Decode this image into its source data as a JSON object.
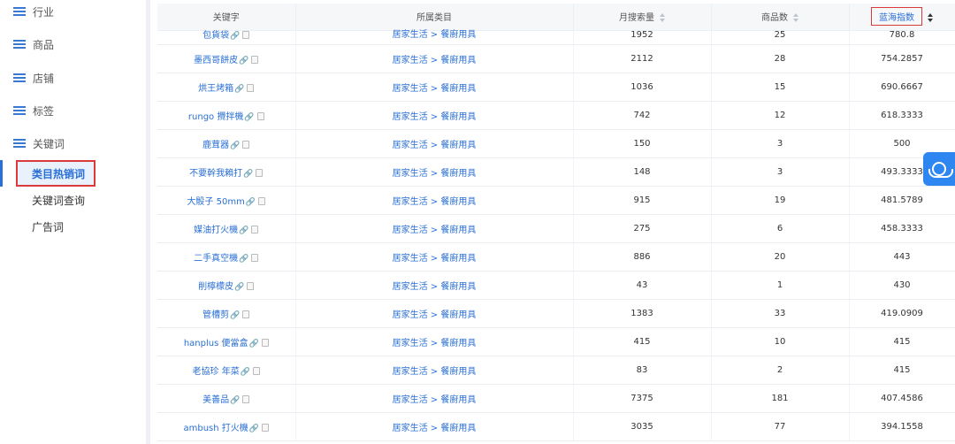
{
  "sidebar": {
    "items": [
      {
        "label": "行业",
        "icon": "list-icon"
      },
      {
        "label": "商品",
        "icon": "list-icon"
      },
      {
        "label": "店铺",
        "icon": "list-icon"
      },
      {
        "label": "标签",
        "icon": "list-icon"
      },
      {
        "label": "关键词",
        "icon": "list-icon"
      }
    ],
    "sub_items": [
      {
        "label": "类目热销词",
        "active": true
      },
      {
        "label": "关键词查询",
        "active": false
      },
      {
        "label": "广告词",
        "active": false
      }
    ]
  },
  "table": {
    "headers": [
      "关键字",
      "所属类目",
      "月搜索量",
      "商品数",
      "蓝海指数"
    ],
    "rows": [
      {
        "keyword": "包貨袋",
        "category": "居家生活 > 餐廚用具",
        "monthly_search": "1952",
        "products": "25",
        "blue_ocean": "780.8"
      },
      {
        "keyword": "墨西哥餅皮",
        "category": "居家生活 > 餐廚用具",
        "monthly_search": "2112",
        "products": "28",
        "blue_ocean": "754.2857"
      },
      {
        "keyword": "烘王烤箱",
        "category": "居家生活 > 餐廚用具",
        "monthly_search": "1036",
        "products": "15",
        "blue_ocean": "690.6667"
      },
      {
        "keyword": "rungo 攪拌機",
        "category": "居家生活 > 餐廚用具",
        "monthly_search": "742",
        "products": "12",
        "blue_ocean": "618.3333"
      },
      {
        "keyword": "鹿茸器",
        "category": "居家生活 > 餐廚用具",
        "monthly_search": "150",
        "products": "3",
        "blue_ocean": "500"
      },
      {
        "keyword": "不要幹我賴打",
        "category": "居家生活 > 餐廚用具",
        "monthly_search": "148",
        "products": "3",
        "blue_ocean": "493.3333"
      },
      {
        "keyword": "大骰子 50mm",
        "category": "居家生活 > 餐廚用具",
        "monthly_search": "915",
        "products": "19",
        "blue_ocean": "481.5789"
      },
      {
        "keyword": "媒油打火機",
        "category": "居家生活 > 餐廚用具",
        "monthly_search": "275",
        "products": "6",
        "blue_ocean": "458.3333"
      },
      {
        "keyword": "二手真空機",
        "category": "居家生活 > 餐廚用具",
        "monthly_search": "886",
        "products": "20",
        "blue_ocean": "443"
      },
      {
        "keyword": "削檸檬皮",
        "category": "居家生活 > 餐廚用具",
        "monthly_search": "43",
        "products": "1",
        "blue_ocean": "430"
      },
      {
        "keyword": "管槽剪",
        "category": "居家生活 > 餐廚用具",
        "monthly_search": "1383",
        "products": "33",
        "blue_ocean": "419.0909"
      },
      {
        "keyword": "hanplus 便當盒",
        "category": "居家生活 > 餐廚用具",
        "monthly_search": "415",
        "products": "10",
        "blue_ocean": "415"
      },
      {
        "keyword": "老協珍 年菜",
        "category": "居家生活 > 餐廚用具",
        "monthly_search": "83",
        "products": "2",
        "blue_ocean": "415"
      },
      {
        "keyword": "美善品",
        "category": "居家生活 > 餐廚用具",
        "monthly_search": "7375",
        "products": "181",
        "blue_ocean": "407.4586"
      },
      {
        "keyword": "ambush 打火機",
        "category": "居家生活 > 餐廚用具",
        "monthly_search": "3035",
        "products": "77",
        "blue_ocean": "394.1558"
      }
    ]
  },
  "link_glyph": "🔗",
  "colors": {
    "accent": "#2a6fd6",
    "highlight_border": "#d93a3a",
    "header_bg": "#f6f7f9"
  },
  "customer_service_icon": "headset-icon"
}
